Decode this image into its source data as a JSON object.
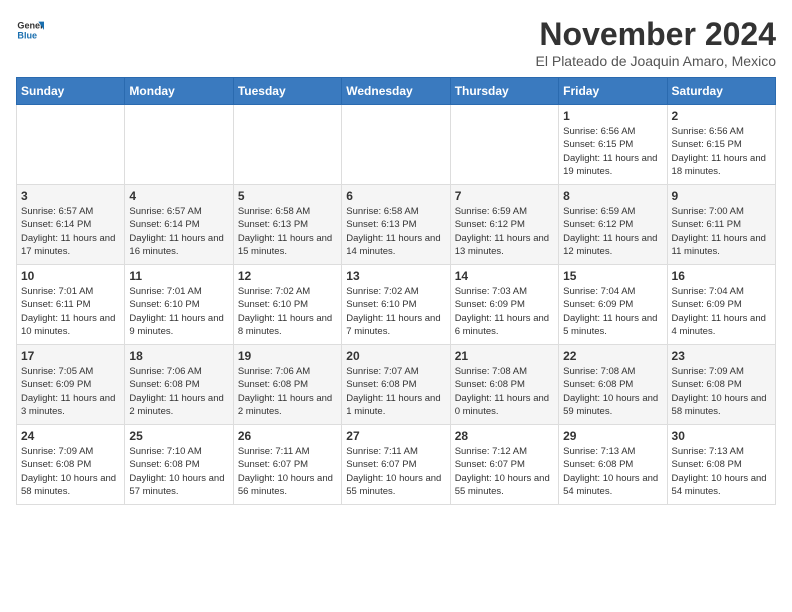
{
  "header": {
    "logo_general": "General",
    "logo_blue": "Blue",
    "month_title": "November 2024",
    "location": "El Plateado de Joaquin Amaro, Mexico"
  },
  "weekdays": [
    "Sunday",
    "Monday",
    "Tuesday",
    "Wednesday",
    "Thursday",
    "Friday",
    "Saturday"
  ],
  "weeks": [
    [
      {
        "day": "",
        "info": ""
      },
      {
        "day": "",
        "info": ""
      },
      {
        "day": "",
        "info": ""
      },
      {
        "day": "",
        "info": ""
      },
      {
        "day": "",
        "info": ""
      },
      {
        "day": "1",
        "info": "Sunrise: 6:56 AM\nSunset: 6:15 PM\nDaylight: 11 hours and 19 minutes."
      },
      {
        "day": "2",
        "info": "Sunrise: 6:56 AM\nSunset: 6:15 PM\nDaylight: 11 hours and 18 minutes."
      }
    ],
    [
      {
        "day": "3",
        "info": "Sunrise: 6:57 AM\nSunset: 6:14 PM\nDaylight: 11 hours and 17 minutes."
      },
      {
        "day": "4",
        "info": "Sunrise: 6:57 AM\nSunset: 6:14 PM\nDaylight: 11 hours and 16 minutes."
      },
      {
        "day": "5",
        "info": "Sunrise: 6:58 AM\nSunset: 6:13 PM\nDaylight: 11 hours and 15 minutes."
      },
      {
        "day": "6",
        "info": "Sunrise: 6:58 AM\nSunset: 6:13 PM\nDaylight: 11 hours and 14 minutes."
      },
      {
        "day": "7",
        "info": "Sunrise: 6:59 AM\nSunset: 6:12 PM\nDaylight: 11 hours and 13 minutes."
      },
      {
        "day": "8",
        "info": "Sunrise: 6:59 AM\nSunset: 6:12 PM\nDaylight: 11 hours and 12 minutes."
      },
      {
        "day": "9",
        "info": "Sunrise: 7:00 AM\nSunset: 6:11 PM\nDaylight: 11 hours and 11 minutes."
      }
    ],
    [
      {
        "day": "10",
        "info": "Sunrise: 7:01 AM\nSunset: 6:11 PM\nDaylight: 11 hours and 10 minutes."
      },
      {
        "day": "11",
        "info": "Sunrise: 7:01 AM\nSunset: 6:10 PM\nDaylight: 11 hours and 9 minutes."
      },
      {
        "day": "12",
        "info": "Sunrise: 7:02 AM\nSunset: 6:10 PM\nDaylight: 11 hours and 8 minutes."
      },
      {
        "day": "13",
        "info": "Sunrise: 7:02 AM\nSunset: 6:10 PM\nDaylight: 11 hours and 7 minutes."
      },
      {
        "day": "14",
        "info": "Sunrise: 7:03 AM\nSunset: 6:09 PM\nDaylight: 11 hours and 6 minutes."
      },
      {
        "day": "15",
        "info": "Sunrise: 7:04 AM\nSunset: 6:09 PM\nDaylight: 11 hours and 5 minutes."
      },
      {
        "day": "16",
        "info": "Sunrise: 7:04 AM\nSunset: 6:09 PM\nDaylight: 11 hours and 4 minutes."
      }
    ],
    [
      {
        "day": "17",
        "info": "Sunrise: 7:05 AM\nSunset: 6:09 PM\nDaylight: 11 hours and 3 minutes."
      },
      {
        "day": "18",
        "info": "Sunrise: 7:06 AM\nSunset: 6:08 PM\nDaylight: 11 hours and 2 minutes."
      },
      {
        "day": "19",
        "info": "Sunrise: 7:06 AM\nSunset: 6:08 PM\nDaylight: 11 hours and 2 minutes."
      },
      {
        "day": "20",
        "info": "Sunrise: 7:07 AM\nSunset: 6:08 PM\nDaylight: 11 hours and 1 minute."
      },
      {
        "day": "21",
        "info": "Sunrise: 7:08 AM\nSunset: 6:08 PM\nDaylight: 11 hours and 0 minutes."
      },
      {
        "day": "22",
        "info": "Sunrise: 7:08 AM\nSunset: 6:08 PM\nDaylight: 10 hours and 59 minutes."
      },
      {
        "day": "23",
        "info": "Sunrise: 7:09 AM\nSunset: 6:08 PM\nDaylight: 10 hours and 58 minutes."
      }
    ],
    [
      {
        "day": "24",
        "info": "Sunrise: 7:09 AM\nSunset: 6:08 PM\nDaylight: 10 hours and 58 minutes."
      },
      {
        "day": "25",
        "info": "Sunrise: 7:10 AM\nSunset: 6:08 PM\nDaylight: 10 hours and 57 minutes."
      },
      {
        "day": "26",
        "info": "Sunrise: 7:11 AM\nSunset: 6:07 PM\nDaylight: 10 hours and 56 minutes."
      },
      {
        "day": "27",
        "info": "Sunrise: 7:11 AM\nSunset: 6:07 PM\nDaylight: 10 hours and 55 minutes."
      },
      {
        "day": "28",
        "info": "Sunrise: 7:12 AM\nSunset: 6:07 PM\nDaylight: 10 hours and 55 minutes."
      },
      {
        "day": "29",
        "info": "Sunrise: 7:13 AM\nSunset: 6:08 PM\nDaylight: 10 hours and 54 minutes."
      },
      {
        "day": "30",
        "info": "Sunrise: 7:13 AM\nSunset: 6:08 PM\nDaylight: 10 hours and 54 minutes."
      }
    ]
  ]
}
